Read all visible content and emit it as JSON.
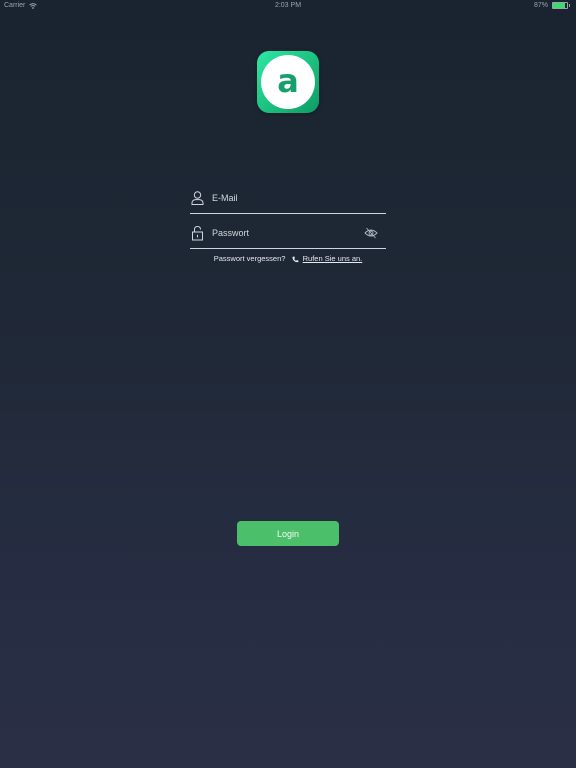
{
  "status_bar": {
    "carrier": "Carrier",
    "time": "2:03 PM",
    "battery_text": "87%",
    "battery_level": 0.87,
    "icons": {
      "wifi": "wifi-icon",
      "battery": "battery-icon"
    }
  },
  "logo": {
    "letter": "a",
    "icon": "app-logo",
    "colors": {
      "gradient_start": "#2fe7a4",
      "gradient_end": "#0f9a64",
      "letter": "#17a06b"
    }
  },
  "form": {
    "email": {
      "placeholder": "E-Mail",
      "value": "",
      "icon": "user-icon"
    },
    "password": {
      "placeholder": "Passwort",
      "value": "",
      "icon": "lock-icon",
      "toggle_icon": "eye-slash-icon"
    }
  },
  "forgot": {
    "text": "Passwort vergessen?",
    "icon": "phone-icon",
    "link_text": "Rufen Sie uns an."
  },
  "login": {
    "label": "Login",
    "color": "#4cbf6a"
  },
  "theme": {
    "background_top": "#1a2430",
    "background_bottom": "#2a2f46",
    "text": "#e6e9ee"
  }
}
